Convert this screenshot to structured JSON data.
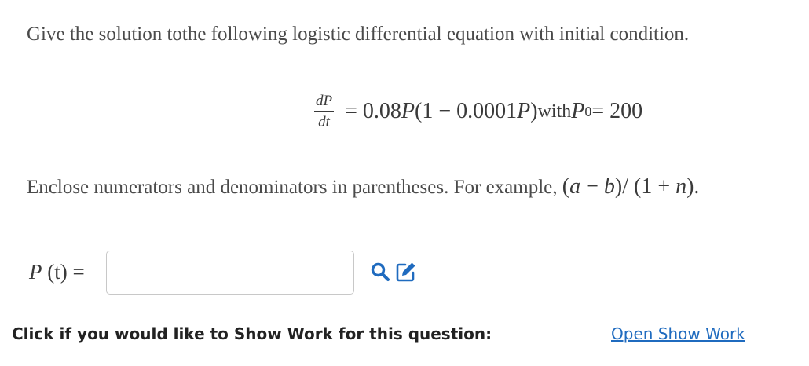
{
  "question": {
    "text": "Give the solution tothe following logistic differential equation with initial condition."
  },
  "equation": {
    "numerator": "dP",
    "denominator": "dt",
    "equals": "=",
    "rhs_coef": "0.08",
    "rhs_var": "P",
    "rhs_paren_open": " (1 − 0.0001",
    "rhs_paren_var": "P",
    "rhs_paren_close": ")",
    "with_word": " with ",
    "init_var": "P",
    "init_sub": "0",
    "init_equals": " = 200"
  },
  "instructions": {
    "text": "Enclose numerators and denominators in parentheses. For example, ",
    "example_a": "a",
    "example_mid": " − ",
    "example_b": "b",
    "example_rest": ")/ (1 + ",
    "example_n": "n",
    "example_end": ")."
  },
  "answer": {
    "label_var": "P",
    "label_arg": " (t) =",
    "value": "",
    "placeholder": ""
  },
  "icons": {
    "search": "magnifier-icon",
    "edit": "edit-pencil-icon",
    "accent_color": "#1f6bbf"
  },
  "show_work": {
    "prompt": "Click if you would like to Show Work for this question:",
    "link_label": "Open Show Work"
  }
}
